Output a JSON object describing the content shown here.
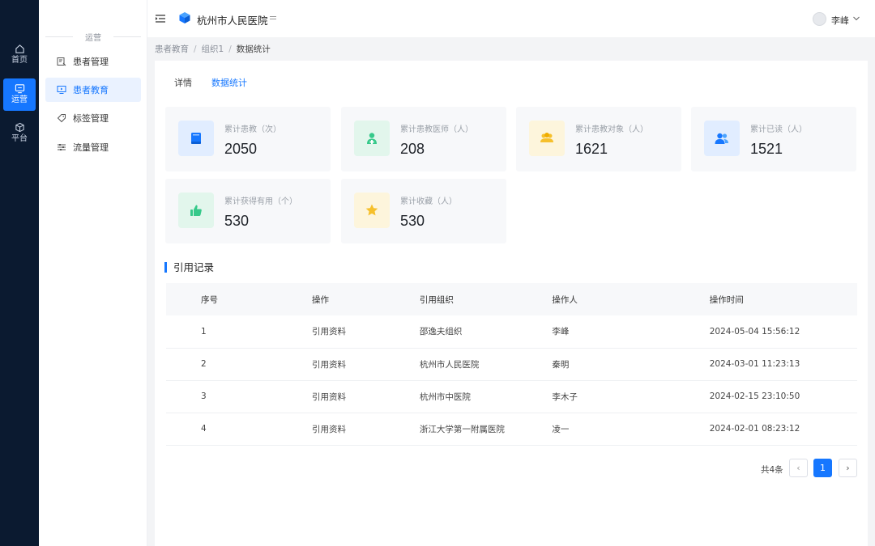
{
  "rail": {
    "items": [
      {
        "label": "首页"
      },
      {
        "label": "运营"
      },
      {
        "label": "平台"
      }
    ]
  },
  "submenu": {
    "group_title": "运营",
    "items": [
      {
        "label": "患者管理"
      },
      {
        "label": "患者教育"
      },
      {
        "label": "标签管理"
      },
      {
        "label": "流量管理"
      }
    ]
  },
  "header": {
    "title": "杭州市人民医院",
    "user_name": "李峰"
  },
  "breadcrumb": [
    "患者教育",
    "组织1",
    "数据统计"
  ],
  "tabs": [
    {
      "label": "详情"
    },
    {
      "label": "数据统计"
    }
  ],
  "stats": [
    {
      "label": "累计患教（次）",
      "value": "2050",
      "icon": "book-icon",
      "color": "#1677ff"
    },
    {
      "label": "累计患教医师（人）",
      "value": "208",
      "icon": "doctor-icon",
      "color": "#36c98a"
    },
    {
      "label": "累计患教对象（人）",
      "value": "1621",
      "icon": "crowd-icon",
      "color": "#f6c02c"
    },
    {
      "label": "累计已读（人）",
      "value": "1521",
      "icon": "users-icon",
      "color": "#1677ff"
    },
    {
      "label": "累计获得有用（个）",
      "value": "530",
      "icon": "thumbs-up-icon",
      "color": "#36c98a"
    },
    {
      "label": "累计收藏（人）",
      "value": "530",
      "icon": "star-icon",
      "color": "#f6c02c"
    }
  ],
  "records": {
    "title": "引用记录",
    "columns": [
      "序号",
      "操作",
      "引用组织",
      "操作人",
      "操作时间"
    ],
    "rows": [
      [
        "1",
        "引用资料",
        "邵逸夫组织",
        "李峰",
        "2024-05-04 15:56:12"
      ],
      [
        "2",
        "引用资料",
        "杭州市人民医院",
        "秦明",
        "2024-03-01 11:23:13"
      ],
      [
        "3",
        "引用资料",
        "杭州市中医院",
        "李木子",
        "2024-02-15 23:10:50"
      ],
      [
        "4",
        "引用资料",
        "浙江大学第一附属医院",
        "凌一",
        "2024-02-01 08:23:12"
      ]
    ]
  },
  "pagination": {
    "total": "共4条",
    "prev": "‹",
    "current": "1",
    "next": "›"
  }
}
